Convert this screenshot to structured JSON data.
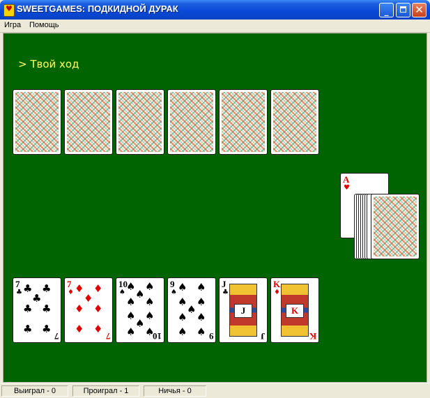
{
  "window": {
    "title": "SWEETGAMES: ПОДКИДНОЙ ДУРАК",
    "minimize_label": "_",
    "close_label": "✕"
  },
  "menu": {
    "items": [
      "Игра",
      "Помощь"
    ]
  },
  "game": {
    "turn_text": "> Твой ход",
    "opponent_hand_count": 6,
    "trump_card": {
      "rank": "A",
      "suit": "♥",
      "color": "red"
    },
    "player_hand": [
      {
        "rank": "7",
        "suit": "♣",
        "color": "black"
      },
      {
        "rank": "7",
        "suit": "♦",
        "color": "red"
      },
      {
        "rank": "10",
        "suit": "♠",
        "color": "black"
      },
      {
        "rank": "9",
        "suit": "♠",
        "color": "black"
      },
      {
        "rank": "J",
        "suit": "♣",
        "color": "black"
      },
      {
        "rank": "K",
        "suit": "♦",
        "color": "red"
      }
    ]
  },
  "status": {
    "won": "Выиграл - 0",
    "lost": "Проиграл - 1",
    "draw": "Ничья - 0"
  },
  "colors": {
    "table": "#006400",
    "turn_text": "#ffff66",
    "title_bar": "#0a49d8",
    "red_suit": "#e00000"
  }
}
